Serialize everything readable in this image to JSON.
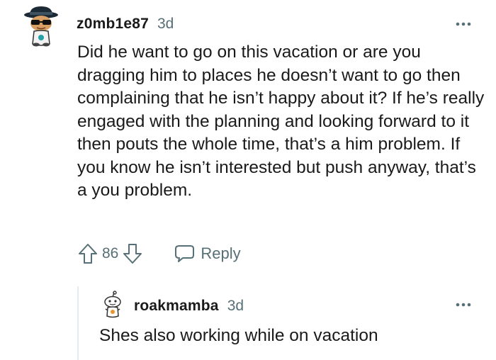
{
  "comment": {
    "username": "z0mb1e87",
    "timestamp": "3d",
    "body": "Did he want to go on this vacation or are you dragging him to places he doesn’t want to go then complaining that he isn’t happy about it? If he’s really engaged with the planning and looking forward to it then pouts the whole time, that’s a him problem. If you know he isn’t interested but push anyway, that’s a you problem.",
    "score": "86",
    "reply_label": "Reply",
    "avatar_icon": "snoo-avatar-icon",
    "more_icon": "more-options-icon"
  },
  "reply": {
    "username": "roakmamba",
    "timestamp": "3d",
    "body": "Shes also working while on vacation",
    "avatar_icon": "snoo-avatar-icon",
    "more_icon": "more-options-icon"
  },
  "colors": {
    "text_primary": "#1a1a1b",
    "text_secondary": "#576f76",
    "thread_line": "#e5ebee"
  }
}
